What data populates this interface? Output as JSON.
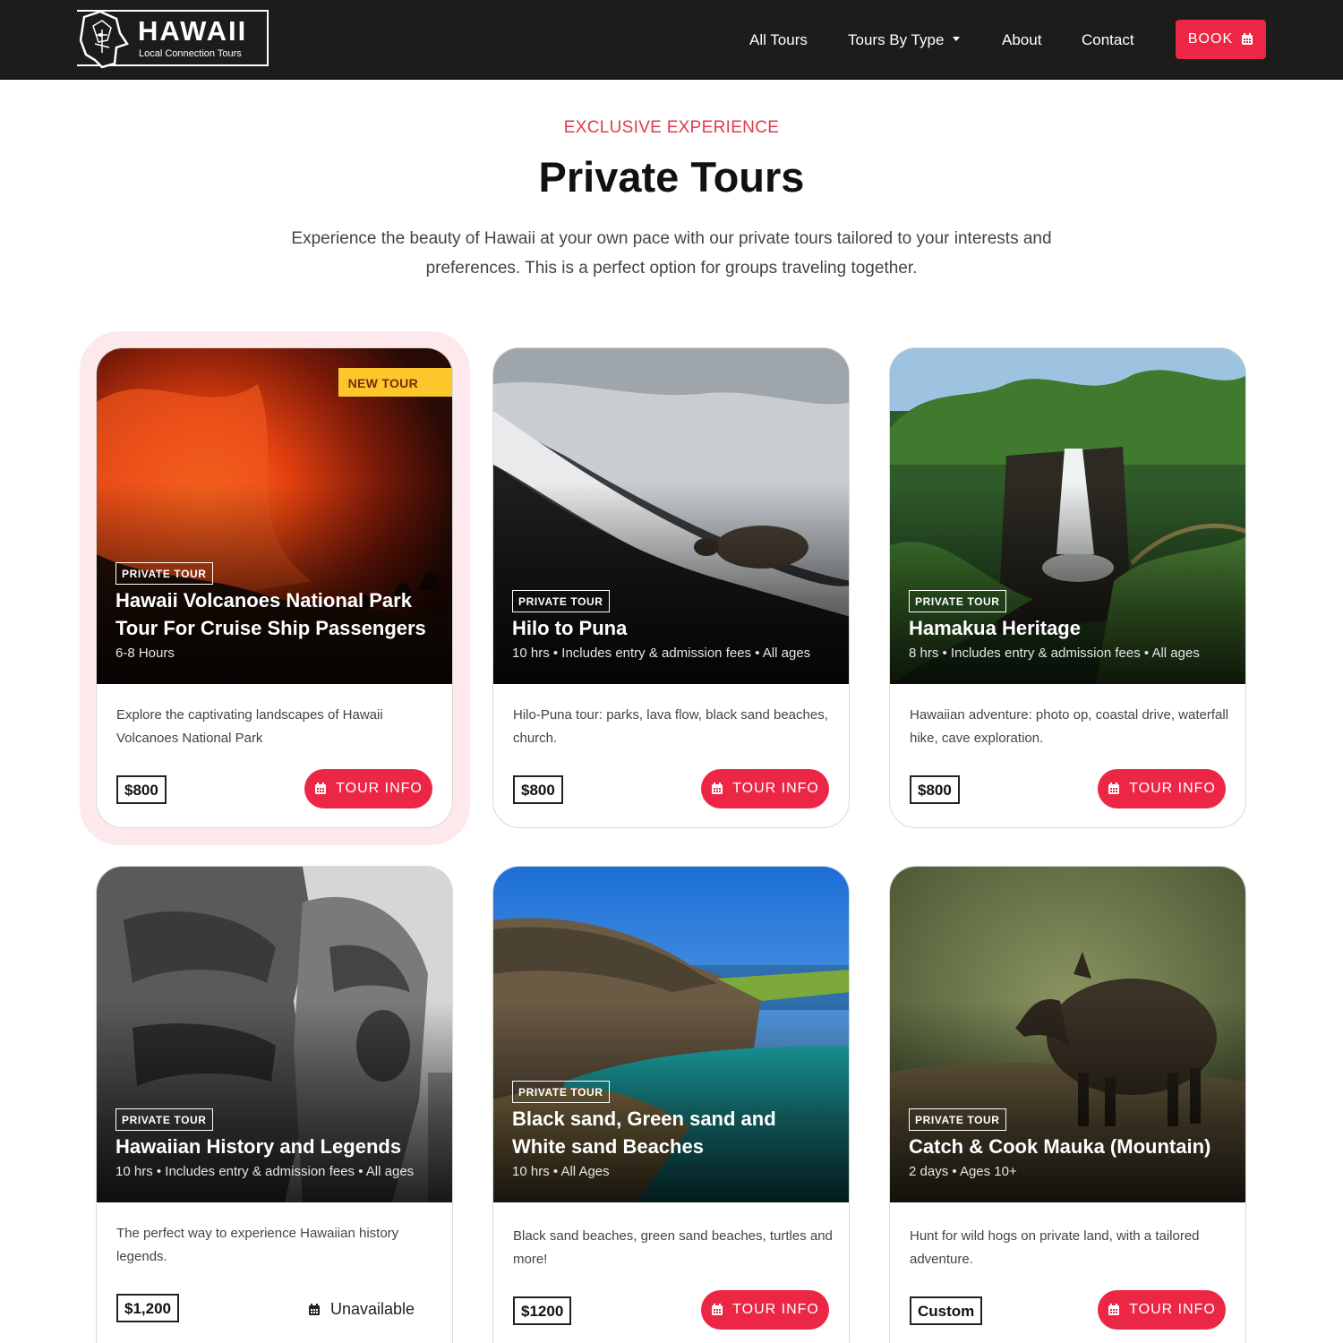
{
  "nav": {
    "logo_title": "HAWAII",
    "logo_subtitle": "Local Connection Tours",
    "links": [
      "All Tours",
      "Tours By Type",
      "About",
      "Contact"
    ],
    "book_label": "BOOK"
  },
  "header": {
    "eyebrow": "EXCLUSIVE EXPERIENCE",
    "title": "Private Tours",
    "intro": "Experience the beauty of Hawaii at your own pace with our private tours tailored to your interests and preferences. This is a perfect option for groups traveling together."
  },
  "colors": {
    "accent": "#ec2746",
    "nav_bg": "#1c1c1d",
    "badge": "#fcc72a",
    "highlight": "#fde8ec"
  },
  "cards": [
    {
      "tag": "PRIVATE TOUR",
      "badge": "NEW TOUR",
      "title": "Hawaii Volcanoes National Park Tour For Cruise Ship Passengers",
      "meta": "6-8 Hours",
      "description": "Explore the captivating landscapes of Hawaii Volcanoes National Park",
      "price": "$800",
      "button": "TOUR INFO",
      "image": "volcano eruption"
    },
    {
      "tag": "PRIVATE TOUR",
      "title": "Hilo to Puna",
      "meta": "10 hrs • Includes entry & admission fees • All ages",
      "description": "Hilo-Puna tour: parks, lava flow, black sand beaches, church.",
      "price": "$800",
      "button": "TOUR INFO",
      "image": "sea turtle on black sand beach"
    },
    {
      "tag": "PRIVATE TOUR",
      "title": "Hamakua Heritage",
      "meta": "8 hrs • Includes entry & admission fees • All ages",
      "description": "Hawaiian adventure: photo op, coastal drive, waterfall hike, cave exploration.",
      "price": "$800",
      "button": "TOUR INFO",
      "image": "waterfall with rainbow"
    },
    {
      "tag": "PRIVATE TOUR",
      "title": "Hawaiian History and Legends",
      "meta": "10 hrs • Includes entry & admission fees • All ages",
      "description": "The perfect way to experience Hawaiian history legends.",
      "price": "$1,200",
      "status": "Unavailable",
      "image": "carved tiki statues"
    },
    {
      "tag": "PRIVATE TOUR",
      "title": "Black sand, Green sand and White sand Beaches",
      "meta": "10 hrs • All Ages",
      "description": "Black sand beaches, green sand beaches, turtles and more!",
      "price": "$1200",
      "button": "TOUR INFO",
      "image": "green sand beach cliffs"
    },
    {
      "tag": "PRIVATE TOUR",
      "title": "Catch & Cook Mauka (Mountain)",
      "meta": "2 days • Ages 10+",
      "description": "Hunt for wild hogs on private land, with a tailored adventure.",
      "price": "Custom",
      "button": "TOUR INFO",
      "image": "wild boar"
    }
  ]
}
